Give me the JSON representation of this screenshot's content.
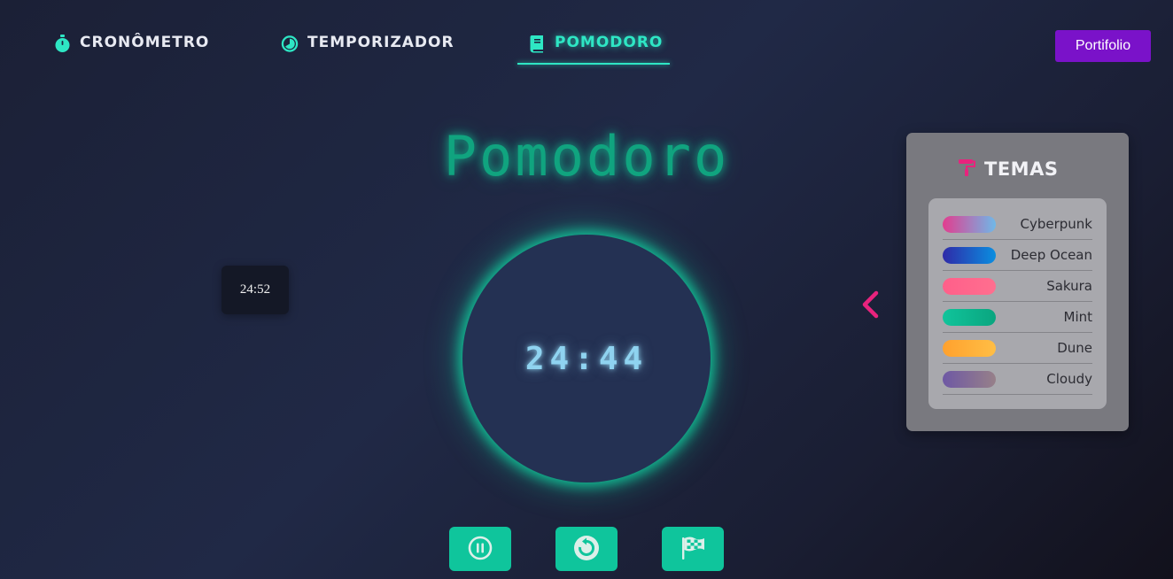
{
  "nav": {
    "items": [
      {
        "label": "CRONÔMETRO",
        "icon": "stopwatch-icon"
      },
      {
        "label": "TEMPORIZADOR",
        "icon": "clock-icon"
      },
      {
        "label": "POMODORO",
        "icon": "book-icon",
        "active": true
      }
    ],
    "portfolio_label": "Portifolio"
  },
  "page": {
    "title": "Pomodoro"
  },
  "mini_timer": {
    "value": "24:52"
  },
  "timer": {
    "display": "24:44"
  },
  "controls": [
    {
      "name": "pause",
      "icon": "pause-icon"
    },
    {
      "name": "reset",
      "icon": "reset-icon"
    },
    {
      "name": "finish",
      "icon": "checkered-flag-icon"
    }
  ],
  "themes": {
    "title": "TEMAS",
    "icon": "paint-roller-icon",
    "items": [
      {
        "name": "Cyberpunk",
        "colors": [
          "#e23d8f",
          "#6fb8e8"
        ]
      },
      {
        "name": "Deep Ocean",
        "colors": [
          "#2f2aa8",
          "#0a8ee0"
        ]
      },
      {
        "name": "Sakura",
        "colors": [
          "#ff5f8a",
          "#ff6f8f"
        ]
      },
      {
        "name": "Mint",
        "colors": [
          "#10c49b",
          "#0aa57f"
        ]
      },
      {
        "name": "Dune",
        "colors": [
          "#ffa12e",
          "#ffbe45"
        ]
      },
      {
        "name": "Cloudy",
        "colors": [
          "#6e58a4",
          "#978089"
        ]
      }
    ]
  },
  "colors": {
    "accent": "#2ee6c4",
    "button": "#0fc59c",
    "portfolio": "#7a12c9",
    "chevron": "#e8237d"
  }
}
